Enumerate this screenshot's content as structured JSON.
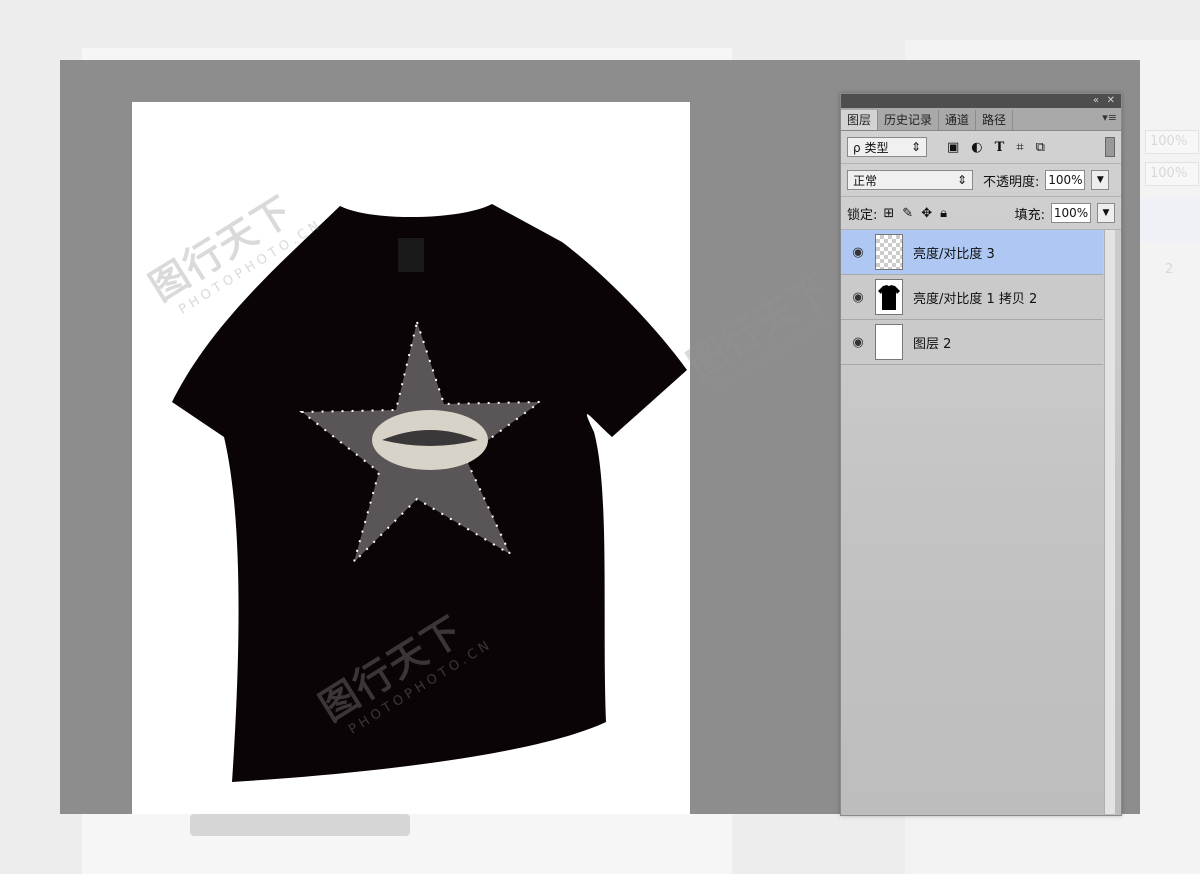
{
  "app": {
    "watermark_main": "图行天下",
    "watermark_sub": "PHOTOPHOTO.CN"
  },
  "background_ghost": {
    "percent_1": "100%",
    "percent_2": "100%",
    "digit": "2"
  },
  "panel": {
    "tabs": [
      {
        "label": "图层",
        "active": true
      },
      {
        "label": "历史记录",
        "active": false
      },
      {
        "label": "通道",
        "active": false
      },
      {
        "label": "路径",
        "active": false
      }
    ],
    "filter": {
      "search_glyph": "ρ",
      "kind_label": "类型",
      "icons": [
        "image-filter-icon",
        "adjustment-filter-icon",
        "type-filter-icon",
        "shape-filter-icon",
        "smart-object-filter-icon"
      ]
    },
    "blend_mode": "正常",
    "opacity_label": "不透明度:",
    "opacity_value": "100%",
    "lock_label": "锁定:",
    "fill_label": "填充:",
    "fill_value": "100%",
    "layers": [
      {
        "name": "亮度/对比度 3",
        "selected": true,
        "thumb": "transparent-star"
      },
      {
        "name": "亮度/对比度 1 拷贝 2",
        "selected": false,
        "thumb": "black-tshirt"
      },
      {
        "name": "图层 2",
        "selected": false,
        "thumb": "white"
      }
    ]
  },
  "colors": {
    "workspace": "#8d8d8d",
    "selected_layer": "#aec8f3",
    "shirt": "#0a0406",
    "star": "#5a5657"
  }
}
